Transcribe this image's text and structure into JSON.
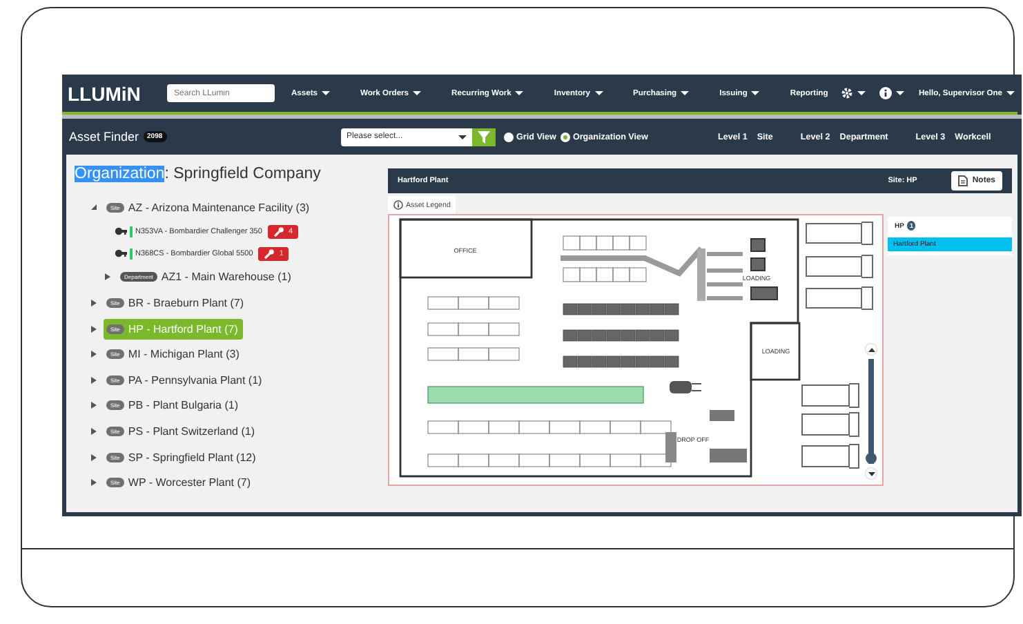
{
  "navbar": {
    "logo": "LLUMiN",
    "search": {
      "placeholder": "Search LLumin"
    },
    "menus": [
      {
        "label": "Assets",
        "dropdown": true
      },
      {
        "label": "Work Orders",
        "dropdown": true
      },
      {
        "label": "Recurring Work",
        "dropdown": true
      },
      {
        "label": "Inventory",
        "dropdown": true
      },
      {
        "label": "Purchasing",
        "dropdown": true
      },
      {
        "label": "Issuing",
        "dropdown": true
      },
      {
        "label": "Reporting",
        "dropdown": false
      }
    ],
    "user": "Hello, Supervisor One"
  },
  "asset_finder": {
    "title": "Asset Finder",
    "count": "2098",
    "select": {
      "placeholder": "Please select..."
    },
    "views": [
      {
        "label": "Grid View",
        "selected": false
      },
      {
        "label": "Organization View",
        "selected": true
      }
    ],
    "levels": [
      {
        "label": "Level 1",
        "value": "Site"
      },
      {
        "label": "Level 2",
        "value": "Department"
      },
      {
        "label": "Level 3",
        "value": "Workcell"
      }
    ]
  },
  "organization": {
    "label": "Organization",
    "highlighted": true,
    "rest": ": Springfield Company"
  },
  "tree": [
    {
      "kind": "site",
      "tag": "Site",
      "text": "AZ - Arizona Maintenance Facility (3)",
      "expanded": true,
      "selected": false,
      "children": [
        {
          "kind": "asset",
          "text": "N353VA - Bombardier Challenger 350",
          "color": "#2ecc71",
          "work_orders": "4"
        },
        {
          "kind": "asset",
          "text": "N368CS - Bombardier Global 5500",
          "color": "#2ecc71",
          "work_orders": "1"
        },
        {
          "kind": "department",
          "tag": "Department",
          "text": "AZ1 - Main Warehouse (1)",
          "expanded": false,
          "selected": false
        }
      ]
    },
    {
      "kind": "site",
      "tag": "Site",
      "text": "BR - Braeburn Plant (7)",
      "expanded": false,
      "selected": false
    },
    {
      "kind": "site",
      "tag": "Site",
      "text": "HP - Hartford Plant (7)",
      "expanded": false,
      "selected": true
    },
    {
      "kind": "site",
      "tag": "Site",
      "text": "MI - Michigan Plant (3)",
      "expanded": false,
      "selected": false
    },
    {
      "kind": "site",
      "tag": "Site",
      "text": "PA - Pennsylvania Plant (1)",
      "expanded": false,
      "selected": false
    },
    {
      "kind": "site",
      "tag": "Site",
      "text": "PB - Plant Bulgaria (1)",
      "expanded": false,
      "selected": false
    },
    {
      "kind": "site",
      "tag": "Site",
      "text": "PS - Plant Switzerland (1)",
      "expanded": false,
      "selected": false
    },
    {
      "kind": "site",
      "tag": "Site",
      "text": "SP - Springfield Plant (12)",
      "expanded": false,
      "selected": false
    },
    {
      "kind": "site",
      "tag": "Site",
      "text": "WP - Worcester Plant (7)",
      "expanded": false,
      "selected": false
    }
  ],
  "plant_panel": {
    "title": "Hartford Plant",
    "site": "Site: HP",
    "notes_button": "Notes",
    "tab": "Asset Legend",
    "floor_plan": {
      "labels": [
        "OFFICE",
        "LOADING",
        "LOADING",
        "DROP OFF"
      ],
      "zoom": {
        "level": 0
      }
    },
    "side_list": {
      "header": "HP",
      "count": "1",
      "items": [
        {
          "label": "Hartford Plant",
          "selected": true
        }
      ]
    }
  }
}
